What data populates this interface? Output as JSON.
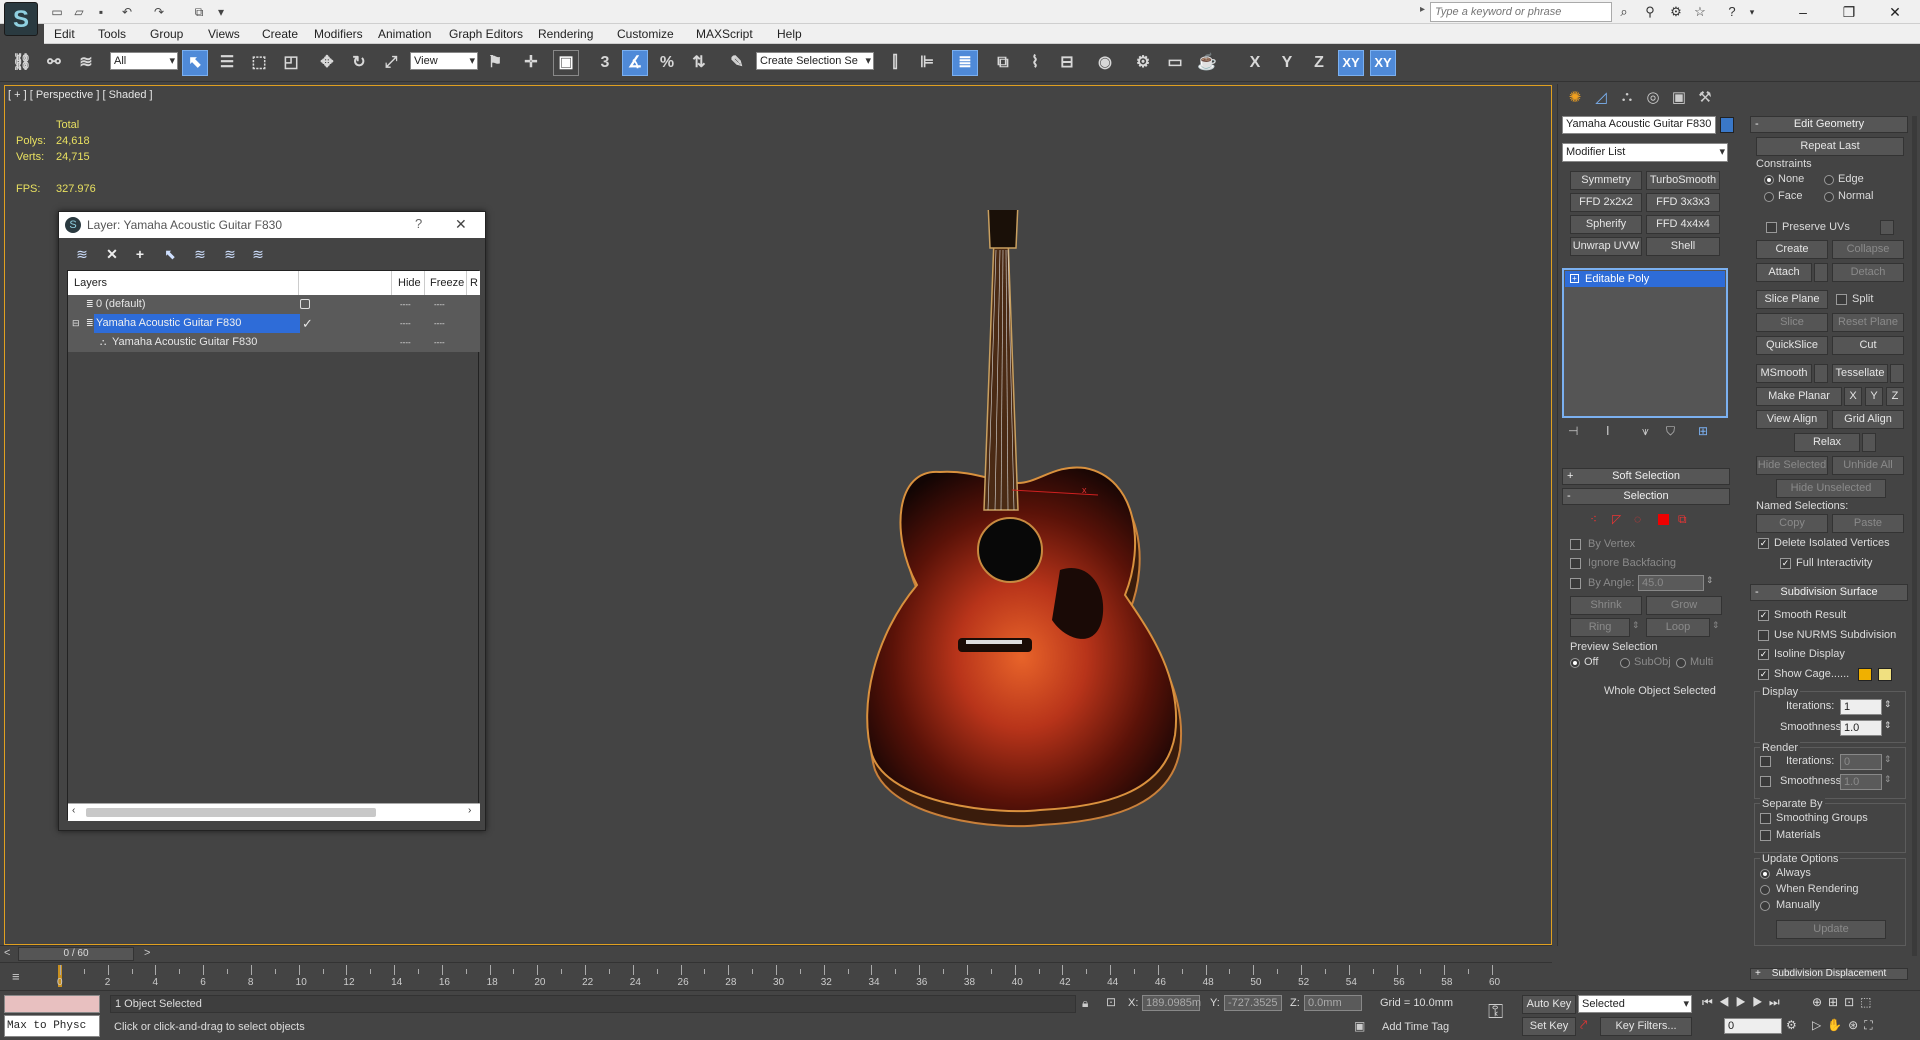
{
  "app": {
    "logo_letter": "S"
  },
  "menu": [
    "Edit",
    "Tools",
    "Group",
    "Views",
    "Create",
    "Modifiers",
    "Animation",
    "Graph Editors",
    "Rendering",
    "Customize",
    "MAXScript",
    "Help"
  ],
  "search": {
    "placeholder": "Type a keyword or phrase"
  },
  "toolbar": {
    "selection_filter": "All",
    "ref_coord": "View",
    "snap_label": "3",
    "named_selection": "Create Selection Se",
    "axes": [
      "X",
      "Y",
      "Z",
      "XY",
      "XY"
    ]
  },
  "viewport": {
    "label": "[ + ] [ Perspective ] [ Shaded ]",
    "stats": {
      "total_label": "Total",
      "polys_label": "Polys:",
      "polys": "24,618",
      "verts_label": "Verts:",
      "verts": "24,715",
      "fps_label": "FPS:",
      "fps": "327.976"
    }
  },
  "layer_dialog": {
    "title": "Layer: Yamaha Acoustic Guitar F830",
    "help": "?",
    "close": "✕",
    "columns": {
      "layers": "Layers",
      "hide": "Hide",
      "freeze": "Freeze",
      "render": "R"
    },
    "rows": [
      {
        "name": "0 (default)",
        "level": 0,
        "selected": false
      },
      {
        "name": "Yamaha Acoustic Guitar F830",
        "level": 0,
        "selected": true
      },
      {
        "name": "Yamaha Acoustic Guitar F830",
        "level": 1,
        "selected": false
      }
    ],
    "row_marks": {
      "hide": "----",
      "freeze": "----"
    }
  },
  "command_panel": {
    "object_name": "Yamaha Acoustic Guitar F830",
    "object_color": "#3a78c8",
    "modifier_list": "Modifier List",
    "modifier_buttons": [
      "Symmetry",
      "TurboSmooth",
      "FFD 2x2x2",
      "FFD 3x3x3",
      "Spherify",
      "FFD 4x4x4",
      "Unwrap UVW",
      "Shell"
    ],
    "stack": [
      "Editable Poly"
    ],
    "soft_selection": "Soft Selection",
    "selection": {
      "header": "Selection",
      "by_vertex": "By Vertex",
      "ignore_backfacing": "Ignore Backfacing",
      "by_angle": "By Angle:",
      "angle_value": "45.0",
      "shrink": "Shrink",
      "grow": "Grow",
      "ring": "Ring",
      "loop": "Loop",
      "preview_label": "Preview Selection",
      "preview_options": [
        "Off",
        "SubObj",
        "Multi"
      ],
      "status": "Whole Object Selected"
    }
  },
  "edit_geometry": {
    "header": "Edit Geometry",
    "repeat_last": "Repeat Last",
    "constraints_label": "Constraints",
    "constraints": [
      "None",
      "Edge",
      "Face",
      "Normal"
    ],
    "preserve_uvs": "Preserve UVs",
    "create": "Create",
    "collapse": "Collapse",
    "attach": "Attach",
    "detach": "Detach",
    "slice_plane": "Slice Plane",
    "split": "Split",
    "slice": "Slice",
    "reset_plane": "Reset Plane",
    "quickslice": "QuickSlice",
    "cut": "Cut",
    "msmooth": "MSmooth",
    "tessellate": "Tessellate",
    "make_planar": "Make Planar",
    "x": "X",
    "y": "Y",
    "z": "Z",
    "view_align": "View Align",
    "grid_align": "Grid Align",
    "relax": "Relax",
    "hide_selected": "Hide Selected",
    "unhide_all": "Unhide All",
    "hide_unselected": "Hide Unselected",
    "named_selections": "Named Selections:",
    "copy": "Copy",
    "paste": "Paste",
    "delete_isolated": "Delete Isolated Vertices",
    "full_interactivity": "Full Interactivity"
  },
  "subdivision": {
    "header": "Subdivision Surface",
    "smooth_result": "Smooth Result",
    "use_nurms": "Use NURMS Subdivision",
    "isoline": "Isoline Display",
    "show_cage": "Show Cage......",
    "cage_colors": [
      "#f0b000",
      "#f0e080"
    ],
    "display_label": "Display",
    "iterations_label": "Iterations:",
    "display_iterations": "1",
    "smoothness_label": "Smoothness:",
    "display_smoothness": "1.0",
    "render_label": "Render",
    "render_iterations": "0",
    "render_smoothness": "1.0",
    "separate_by": "Separate By",
    "smoothing_groups": "Smoothing Groups",
    "materials": "Materials",
    "update_options": "Update Options",
    "always": "Always",
    "when_rendering": "When Rendering",
    "manually": "Manually",
    "update": "Update",
    "subdiv_displacement": "Subdivision Displacement"
  },
  "timeline": {
    "frame": "0 / 60",
    "ticks": [
      "0",
      "2",
      "4",
      "6",
      "8",
      "10",
      "12",
      "14",
      "16",
      "18",
      "20",
      "22",
      "24",
      "26",
      "28",
      "30",
      "32",
      "34",
      "36",
      "38",
      "40",
      "42",
      "44",
      "46",
      "48",
      "50",
      "52",
      "54",
      "56",
      "58",
      "60"
    ]
  },
  "status": {
    "maxscript": "Max to Physc",
    "selected": "1 Object Selected",
    "prompt": "Click or click-and-drag to select objects",
    "x_label": "X:",
    "x": "189.0985m",
    "y_label": "Y:",
    "y": "-727.3525",
    "z_label": "Z:",
    "z": "0.0mm",
    "grid": "Grid = 10.0mm",
    "add_time_tag": "Add Time Tag",
    "auto_key": "Auto Key",
    "set_key": "Set Key",
    "key_mode": "Selected",
    "key_filters": "Key Filters...",
    "frame_value": "0"
  }
}
